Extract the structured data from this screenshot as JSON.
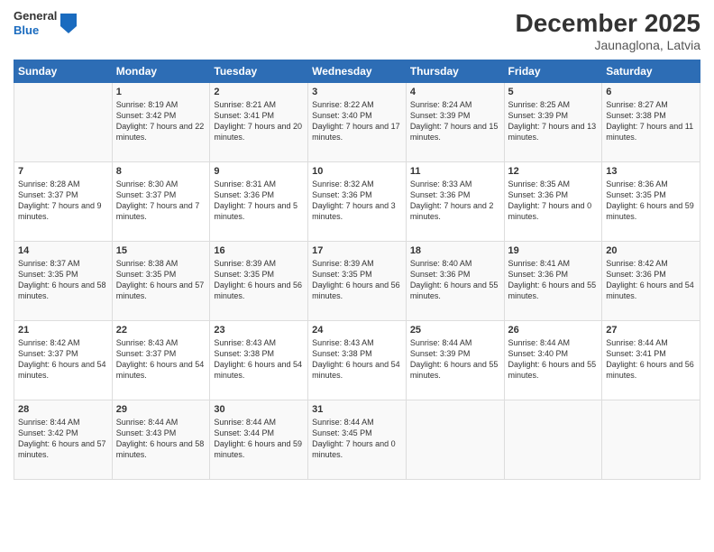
{
  "logo": {
    "general": "General",
    "blue": "Blue"
  },
  "header": {
    "month": "December 2025",
    "location": "Jaunaglona, Latvia"
  },
  "weekdays": [
    "Sunday",
    "Monday",
    "Tuesday",
    "Wednesday",
    "Thursday",
    "Friday",
    "Saturday"
  ],
  "weeks": [
    [
      {
        "day": "",
        "sunrise": "",
        "sunset": "",
        "daylight": ""
      },
      {
        "day": "1",
        "sunrise": "Sunrise: 8:19 AM",
        "sunset": "Sunset: 3:42 PM",
        "daylight": "Daylight: 7 hours and 22 minutes."
      },
      {
        "day": "2",
        "sunrise": "Sunrise: 8:21 AM",
        "sunset": "Sunset: 3:41 PM",
        "daylight": "Daylight: 7 hours and 20 minutes."
      },
      {
        "day": "3",
        "sunrise": "Sunrise: 8:22 AM",
        "sunset": "Sunset: 3:40 PM",
        "daylight": "Daylight: 7 hours and 17 minutes."
      },
      {
        "day": "4",
        "sunrise": "Sunrise: 8:24 AM",
        "sunset": "Sunset: 3:39 PM",
        "daylight": "Daylight: 7 hours and 15 minutes."
      },
      {
        "day": "5",
        "sunrise": "Sunrise: 8:25 AM",
        "sunset": "Sunset: 3:39 PM",
        "daylight": "Daylight: 7 hours and 13 minutes."
      },
      {
        "day": "6",
        "sunrise": "Sunrise: 8:27 AM",
        "sunset": "Sunset: 3:38 PM",
        "daylight": "Daylight: 7 hours and 11 minutes."
      }
    ],
    [
      {
        "day": "7",
        "sunrise": "Sunrise: 8:28 AM",
        "sunset": "Sunset: 3:37 PM",
        "daylight": "Daylight: 7 hours and 9 minutes."
      },
      {
        "day": "8",
        "sunrise": "Sunrise: 8:30 AM",
        "sunset": "Sunset: 3:37 PM",
        "daylight": "Daylight: 7 hours and 7 minutes."
      },
      {
        "day": "9",
        "sunrise": "Sunrise: 8:31 AM",
        "sunset": "Sunset: 3:36 PM",
        "daylight": "Daylight: 7 hours and 5 minutes."
      },
      {
        "day": "10",
        "sunrise": "Sunrise: 8:32 AM",
        "sunset": "Sunset: 3:36 PM",
        "daylight": "Daylight: 7 hours and 3 minutes."
      },
      {
        "day": "11",
        "sunrise": "Sunrise: 8:33 AM",
        "sunset": "Sunset: 3:36 PM",
        "daylight": "Daylight: 7 hours and 2 minutes."
      },
      {
        "day": "12",
        "sunrise": "Sunrise: 8:35 AM",
        "sunset": "Sunset: 3:36 PM",
        "daylight": "Daylight: 7 hours and 0 minutes."
      },
      {
        "day": "13",
        "sunrise": "Sunrise: 8:36 AM",
        "sunset": "Sunset: 3:35 PM",
        "daylight": "Daylight: 6 hours and 59 minutes."
      }
    ],
    [
      {
        "day": "14",
        "sunrise": "Sunrise: 8:37 AM",
        "sunset": "Sunset: 3:35 PM",
        "daylight": "Daylight: 6 hours and 58 minutes."
      },
      {
        "day": "15",
        "sunrise": "Sunrise: 8:38 AM",
        "sunset": "Sunset: 3:35 PM",
        "daylight": "Daylight: 6 hours and 57 minutes."
      },
      {
        "day": "16",
        "sunrise": "Sunrise: 8:39 AM",
        "sunset": "Sunset: 3:35 PM",
        "daylight": "Daylight: 6 hours and 56 minutes."
      },
      {
        "day": "17",
        "sunrise": "Sunrise: 8:39 AM",
        "sunset": "Sunset: 3:35 PM",
        "daylight": "Daylight: 6 hours and 56 minutes."
      },
      {
        "day": "18",
        "sunrise": "Sunrise: 8:40 AM",
        "sunset": "Sunset: 3:36 PM",
        "daylight": "Daylight: 6 hours and 55 minutes."
      },
      {
        "day": "19",
        "sunrise": "Sunrise: 8:41 AM",
        "sunset": "Sunset: 3:36 PM",
        "daylight": "Daylight: 6 hours and 55 minutes."
      },
      {
        "day": "20",
        "sunrise": "Sunrise: 8:42 AM",
        "sunset": "Sunset: 3:36 PM",
        "daylight": "Daylight: 6 hours and 54 minutes."
      }
    ],
    [
      {
        "day": "21",
        "sunrise": "Sunrise: 8:42 AM",
        "sunset": "Sunset: 3:37 PM",
        "daylight": "Daylight: 6 hours and 54 minutes."
      },
      {
        "day": "22",
        "sunrise": "Sunrise: 8:43 AM",
        "sunset": "Sunset: 3:37 PM",
        "daylight": "Daylight: 6 hours and 54 minutes."
      },
      {
        "day": "23",
        "sunrise": "Sunrise: 8:43 AM",
        "sunset": "Sunset: 3:38 PM",
        "daylight": "Daylight: 6 hours and 54 minutes."
      },
      {
        "day": "24",
        "sunrise": "Sunrise: 8:43 AM",
        "sunset": "Sunset: 3:38 PM",
        "daylight": "Daylight: 6 hours and 54 minutes."
      },
      {
        "day": "25",
        "sunrise": "Sunrise: 8:44 AM",
        "sunset": "Sunset: 3:39 PM",
        "daylight": "Daylight: 6 hours and 55 minutes."
      },
      {
        "day": "26",
        "sunrise": "Sunrise: 8:44 AM",
        "sunset": "Sunset: 3:40 PM",
        "daylight": "Daylight: 6 hours and 55 minutes."
      },
      {
        "day": "27",
        "sunrise": "Sunrise: 8:44 AM",
        "sunset": "Sunset: 3:41 PM",
        "daylight": "Daylight: 6 hours and 56 minutes."
      }
    ],
    [
      {
        "day": "28",
        "sunrise": "Sunrise: 8:44 AM",
        "sunset": "Sunset: 3:42 PM",
        "daylight": "Daylight: 6 hours and 57 minutes."
      },
      {
        "day": "29",
        "sunrise": "Sunrise: 8:44 AM",
        "sunset": "Sunset: 3:43 PM",
        "daylight": "Daylight: 6 hours and 58 minutes."
      },
      {
        "day": "30",
        "sunrise": "Sunrise: 8:44 AM",
        "sunset": "Sunset: 3:44 PM",
        "daylight": "Daylight: 6 hours and 59 minutes."
      },
      {
        "day": "31",
        "sunrise": "Sunrise: 8:44 AM",
        "sunset": "Sunset: 3:45 PM",
        "daylight": "Daylight: 7 hours and 0 minutes."
      },
      {
        "day": "",
        "sunrise": "",
        "sunset": "",
        "daylight": ""
      },
      {
        "day": "",
        "sunrise": "",
        "sunset": "",
        "daylight": ""
      },
      {
        "day": "",
        "sunrise": "",
        "sunset": "",
        "daylight": ""
      }
    ]
  ]
}
